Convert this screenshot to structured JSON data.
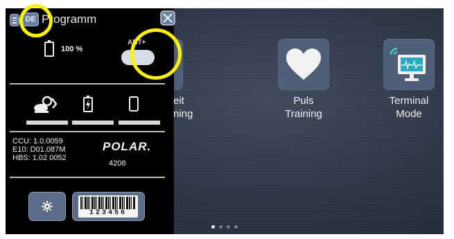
{
  "header": {
    "lang_code": "DE",
    "title": "Programm"
  },
  "status": {
    "battery_percent": "100 %",
    "ant_label": "ANT+"
  },
  "devices": {
    "items": [
      "bike-icon",
      "charging-battery-icon",
      "phone-icon"
    ]
  },
  "versions": {
    "lines": [
      "CCU: 1.0.0059",
      "E10:  D01.087M",
      "HBS: 1.02 0052"
    ],
    "brand": "POLAR.",
    "serial": "4208"
  },
  "tools": {
    "barcode_number": "123456"
  },
  "programs": [
    {
      "label": "eit\nning",
      "icon": "partial-program-icon"
    },
    {
      "label": "Puls\nTraining",
      "icon": "heart-icon"
    },
    {
      "label": "Terminal\nMode",
      "icon": "terminal-monitor-icon"
    }
  ],
  "pager": {
    "count": 4,
    "active": 1
  },
  "colors": {
    "accent_tile": "#4f5f78",
    "highlight_ring": "#fff200",
    "button_blue": "#5b6c8a"
  }
}
